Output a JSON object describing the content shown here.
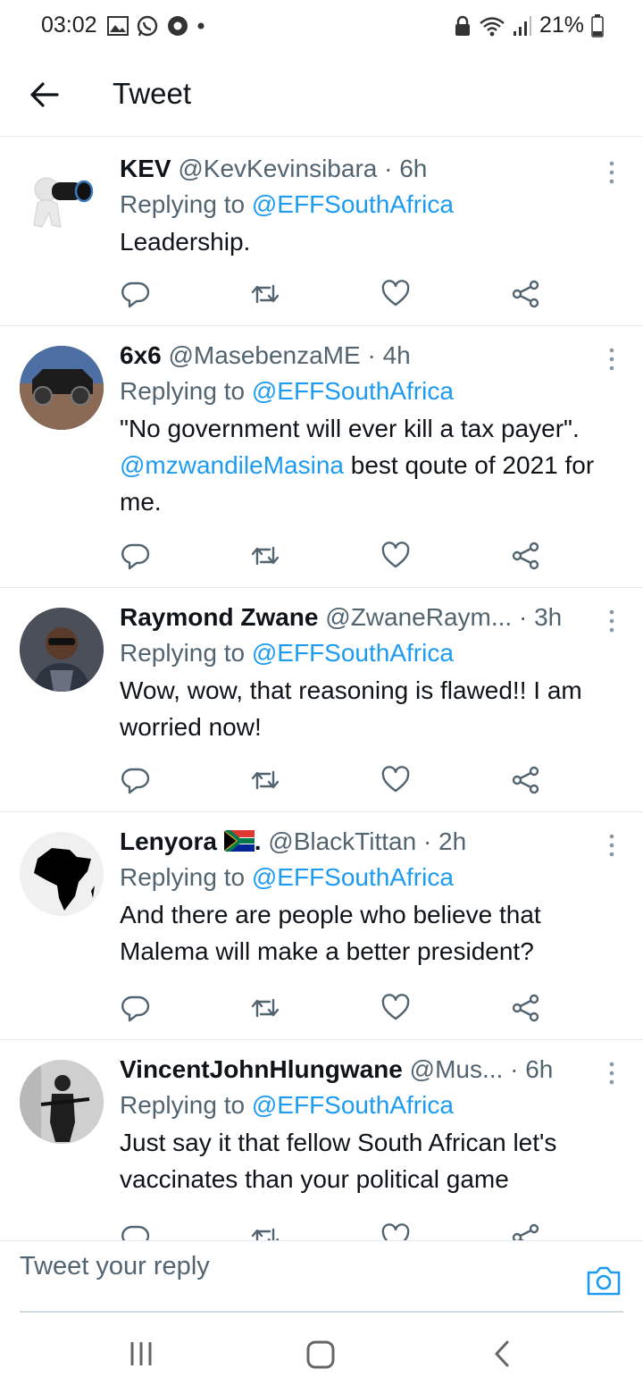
{
  "status_bar": {
    "time": "03:02",
    "battery": "21%"
  },
  "header": {
    "title": "Tweet"
  },
  "tweets": [
    {
      "name": "KEV",
      "handle": "@KevKevinsibara",
      "time": "· 6h",
      "replying_label": "Replying to ",
      "replying_to": "@EFFSouthAfrica",
      "text": "Leadership."
    },
    {
      "name": "6x6",
      "handle": "@MasebenzaME",
      "time": "· 4h",
      "replying_label": "Replying to ",
      "replying_to": "@EFFSouthAfrica",
      "text_part1": "\"No government will ever kill a tax payer\". ",
      "text_mention": "@mzwandileMasina",
      "text_part2": " best qoute of 2021 for me."
    },
    {
      "name": "Raymond Zwane",
      "handle": "@ZwaneRaym...",
      "time": "· 3h",
      "replying_label": "Replying to ",
      "replying_to": "@EFFSouthAfrica",
      "text": "Wow, wow, that reasoning is flawed!! I am worried now!"
    },
    {
      "name": "Lenyora",
      "name_suffix": ".",
      "handle": "@BlackTittan",
      "time": "· 2h",
      "replying_label": "Replying to ",
      "replying_to": "@EFFSouthAfrica",
      "text": "And there are people who believe that Malema will make a better president?"
    },
    {
      "name": "VincentJohnHlungwane",
      "handle": "@Mus...",
      "time": "· 6h",
      "replying_label": "Replying to ",
      "replying_to": "@EFFSouthAfrica",
      "text": "Just say it that fellow South African let's vaccinates than your political game"
    }
  ],
  "reply_box": {
    "placeholder": "Tweet your reply"
  },
  "icons": {
    "back": "arrow-left-icon",
    "more": "more-vertical-icon",
    "reply": "speech-bubble-icon",
    "retweet": "retweet-icon",
    "like": "heart-icon",
    "share": "share-icon",
    "camera": "camera-icon"
  },
  "colors": {
    "accent": "#1d9bf0",
    "text": "#0f1419",
    "secondary": "#536471",
    "divider": "#e6ecf0"
  }
}
